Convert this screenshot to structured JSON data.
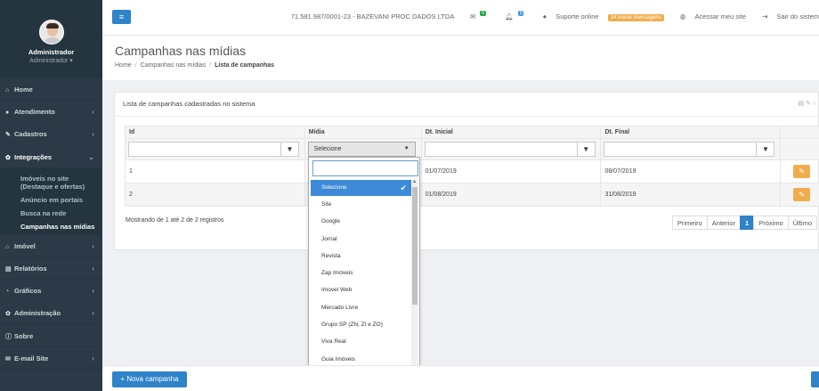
{
  "user": {
    "name": "Administrador",
    "role": "Administrador"
  },
  "sidebar": {
    "items_top": [
      {
        "icon": "home-icon",
        "glyph": "⌂",
        "label": "Home",
        "chev": ""
      },
      {
        "icon": "chat-icon",
        "glyph": "●",
        "label": "Atendimento",
        "chev": "‹"
      },
      {
        "icon": "wrench-icon",
        "glyph": "✎",
        "label": "Cadastros",
        "chev": "‹"
      },
      {
        "icon": "gear-icon",
        "glyph": "✿",
        "label": "Integrações",
        "chev": "⌄"
      }
    ],
    "submenu": [
      {
        "label": "Imóveis no site (Destaque e ofertas)"
      },
      {
        "label": "Anúncio em portais"
      },
      {
        "label": "Busca na rede"
      },
      {
        "label": "Campanhas nas mídias"
      }
    ],
    "items_bottom": [
      {
        "icon": "home-icon",
        "glyph": "⌂",
        "label": "Imóvel",
        "chev": "‹"
      },
      {
        "icon": "file-icon",
        "glyph": "▤",
        "label": "Relatórios",
        "chev": "‹"
      },
      {
        "icon": "chart-icon",
        "glyph": "◔",
        "label": "Gráficos",
        "chev": "‹"
      },
      {
        "icon": "cog-icon",
        "glyph": "✿",
        "label": "Administração",
        "chev": "‹"
      },
      {
        "icon": "info-icon",
        "glyph": "ⓘ",
        "label": "Sobre",
        "chev": ""
      },
      {
        "icon": "mail-icon",
        "glyph": "✉",
        "label": "E-mail Site",
        "chev": "‹"
      }
    ]
  },
  "topbar": {
    "menu_glyph": "≡",
    "company": "71.581.987/0001-23 - BAZEVANI PROC DADOS LTDA",
    "mail_count": "0",
    "bell_count": "0",
    "support": "Suporte online",
    "new_messages": "14 novas mensagens",
    "visit_site": "Acessar meu site",
    "logout": "Sair do sistem"
  },
  "page": {
    "title": "Campanhas nas mídias",
    "breadcrumb": [
      "Home",
      "Campanhas nas mídias",
      "Lista de campanhas"
    ]
  },
  "panel": {
    "title": "Lista de campanhas cadastradas no sistema",
    "tools": "▤ ✎ ○"
  },
  "table": {
    "headers": [
      "Id",
      "Mídia",
      "Dt. Inicial",
      "Dt. Final"
    ],
    "filter_select": "Selecione",
    "rows": [
      {
        "id": "1",
        "midia": "",
        "dt_inicial": "01/07/2019",
        "dt_final": "08/07/2019"
      },
      {
        "id": "2",
        "midia": "",
        "dt_inicial": "01/08/2019",
        "dt_final": "31/08/2019"
      }
    ],
    "showing": "Mostrando de 1 até 2 de 2 registros"
  },
  "pager": [
    "Primeiro",
    "Anterior",
    "1",
    "Próximo",
    "Último"
  ],
  "dropdown": {
    "options": [
      "Selecione",
      "Site",
      "Google",
      "Jornal",
      "Revista",
      "Zap Imóveis",
      "Imovel Web",
      "Mercado Livre",
      "Grupo SP (ZN, ZI e ZO)",
      "Viva Real",
      "Guia Imóveis"
    ],
    "selected": "Selecione"
  },
  "footer": {
    "new_button": "Nova campanha"
  },
  "colors": {
    "sidebar": "#2b3a46",
    "primary": "#2f83c9",
    "edit": "#f0ad4e"
  }
}
